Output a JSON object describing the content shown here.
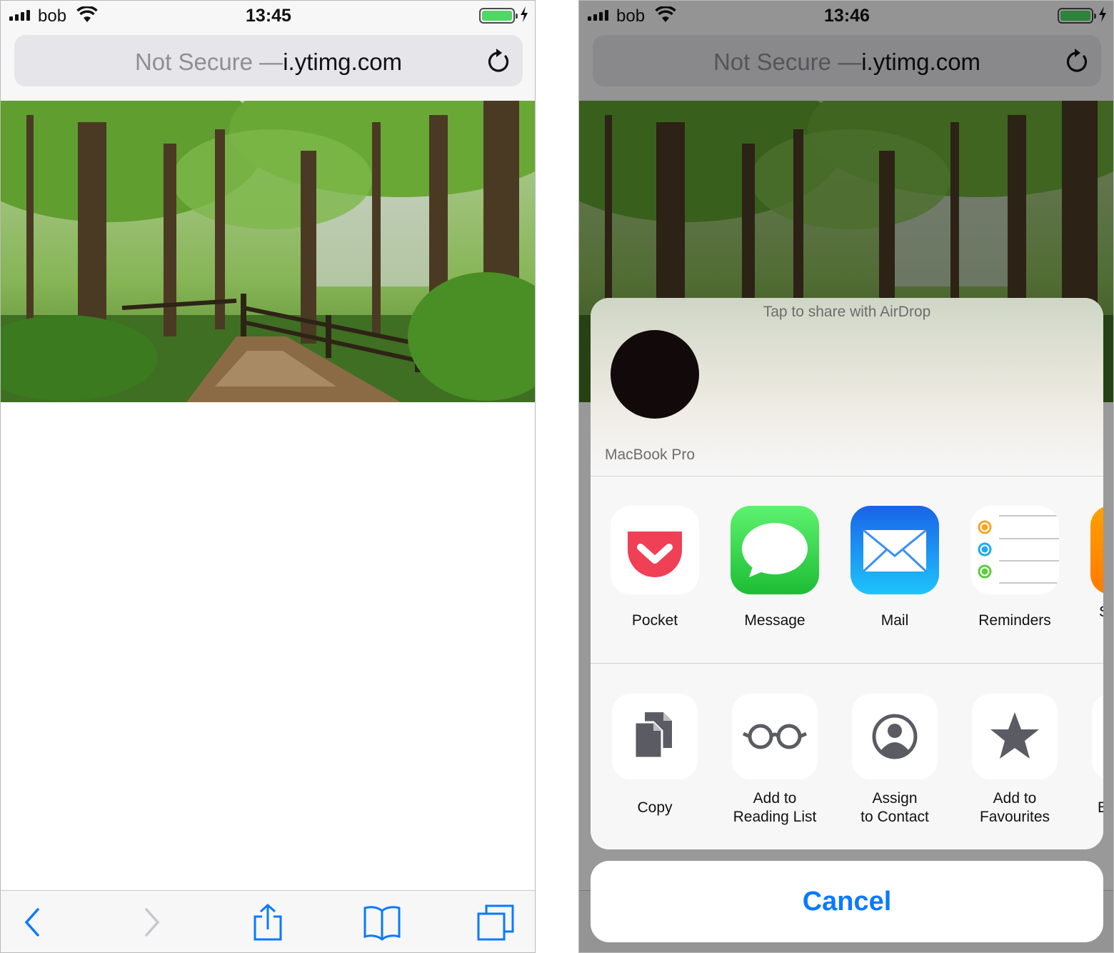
{
  "screens": [
    {
      "status": {
        "carrier": "bob",
        "time": "13:45",
        "battery_level": 1.0
      },
      "address": {
        "prefix": "Not Secure —",
        "domain": "i.ytimg.com"
      }
    },
    {
      "status": {
        "carrier": "bob",
        "time": "13:46",
        "battery_level": 1.0
      },
      "address": {
        "prefix": "Not Secure —",
        "domain": "i.ytimg.com"
      }
    }
  ],
  "share_sheet": {
    "airdrop_title": "Tap to share with AirDrop",
    "airdrop_device": "MacBook Pro",
    "apps": [
      {
        "label": "Pocket",
        "icon": "pocket-icon"
      },
      {
        "label": "Message",
        "icon": "message-icon"
      },
      {
        "label": "Mail",
        "icon": "mail-icon"
      },
      {
        "label": "Reminders",
        "icon": "reminders-icon"
      }
    ],
    "apps_partial_label": "S",
    "actions": [
      {
        "line1": "Copy",
        "line2": "",
        "icon": "copy-icon"
      },
      {
        "line1": "Add to",
        "line2": "Reading List",
        "icon": "glasses-icon"
      },
      {
        "line1": "Assign",
        "line2": "to Contact",
        "icon": "contact-icon"
      },
      {
        "line1": "Add to",
        "line2": "Favourites",
        "icon": "star-icon"
      }
    ],
    "actions_partial_label": "E",
    "cancel_label": "Cancel"
  },
  "colors": {
    "accent": "#0a7aff",
    "battery_green": "#4cd964",
    "pocket_red": "#ef4056",
    "messages_green": "#2dc942",
    "mail_blue": "#1f8bf5"
  }
}
